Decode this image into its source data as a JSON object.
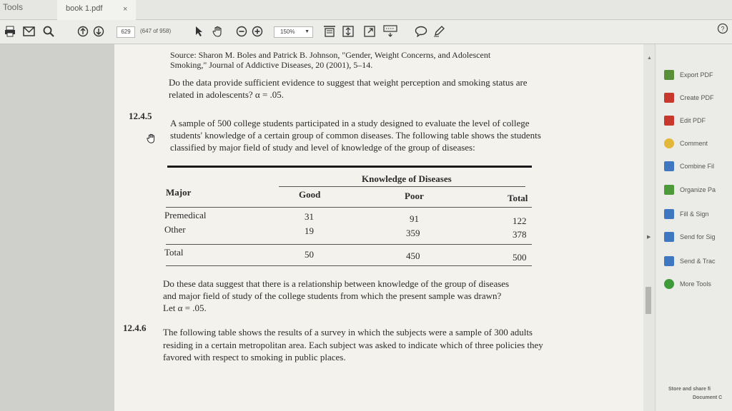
{
  "tabs": {
    "tools": "Tools",
    "file": "book 1.pdf",
    "close": "×"
  },
  "toolbar": {
    "page_current": "629",
    "page_total": "(647 of 958)",
    "zoom": "150%",
    "icons": [
      "print-icon",
      "email-icon",
      "search-icon",
      "page-up-icon",
      "page-down-icon",
      "select-icon",
      "hand-icon",
      "zoom-out-icon",
      "zoom-in-icon",
      "fit-page-icon",
      "scroll-mode-icon",
      "full-screen-icon",
      "keyboard-icon",
      "comment-icon",
      "pen-icon",
      "help-icon"
    ]
  },
  "doc": {
    "source_line1": "Source: Sharon M. Boles and Patrick B. Johnson, \"Gender, Weight Concerns, and Adolescent",
    "source_line2": "Smoking,\" Journal of Addictive Diseases, 20 (2001), 5–14.",
    "q1_line1": "Do the data provide sufficient evidence to suggest that weight perception and smoking status are",
    "q1_line2": "related in adolescents? α = .05.",
    "ex5_num": "12.4.5",
    "ex5_line1": "A sample of 500 college students participated in a study designed to evaluate the level of college",
    "ex5_line2": "students' knowledge of a certain group of common diseases. The following table shows the students",
    "ex5_line3": "classified by major field of study and level of knowledge of the group of diseases:",
    "table": {
      "group_header": "Knowledge of Diseases",
      "col_major": "Major",
      "col_good": "Good",
      "col_poor": "Poor",
      "col_total": "Total",
      "rows": [
        {
          "major": "Premedical",
          "good": "31",
          "poor": "91",
          "total": "122"
        },
        {
          "major": "Other",
          "good": "19",
          "poor": "359",
          "total": "378"
        }
      ],
      "total_row": {
        "major": "Total",
        "good": "50",
        "poor": "450",
        "total": "500"
      }
    },
    "q2_line1": "Do these data suggest that there is a relationship between knowledge of the group of diseases",
    "q2_line2": "and major field of study of the college students from which the present sample was drawn?",
    "q2_line3": "Let α = .05.",
    "ex6_num": "12.4.6",
    "ex6_line1": "The following table shows the results of a survey in which the subjects were a sample of 300 adults",
    "ex6_line2": "residing in a certain metropolitan area. Each subject was asked to indicate which of three policies they",
    "ex6_line3": "favored with respect to smoking in public places."
  },
  "right_pane": {
    "items": [
      {
        "label": "Export PDF",
        "icon": "export-pdf-icon",
        "color": "#5a8f3a"
      },
      {
        "label": "Create PDF",
        "icon": "create-pdf-icon",
        "color": "#c8382c"
      },
      {
        "label": "Edit PDF",
        "icon": "edit-pdf-icon",
        "color": "#c8382c"
      },
      {
        "label": "Comment",
        "icon": "comment-icon",
        "color": "#e3b83a"
      },
      {
        "label": "Combine Fil",
        "icon": "combine-files-icon",
        "color": "#3f78c0"
      },
      {
        "label": "Organize Pa",
        "icon": "organize-pages-icon",
        "color": "#4c9a3a"
      },
      {
        "label": "Fill & Sign",
        "icon": "fill-sign-icon",
        "color": "#3f78c0"
      },
      {
        "label": "Send for Sig",
        "icon": "send-for-signature-icon",
        "color": "#3f78c0"
      },
      {
        "label": "Send & Trac",
        "icon": "send-track-icon",
        "color": "#3f78c0"
      },
      {
        "label": "More Tools",
        "icon": "more-tools-icon",
        "color": "#3f9a3a"
      }
    ],
    "footer_line1": "Store and share fi",
    "footer_line2": "Document C"
  }
}
